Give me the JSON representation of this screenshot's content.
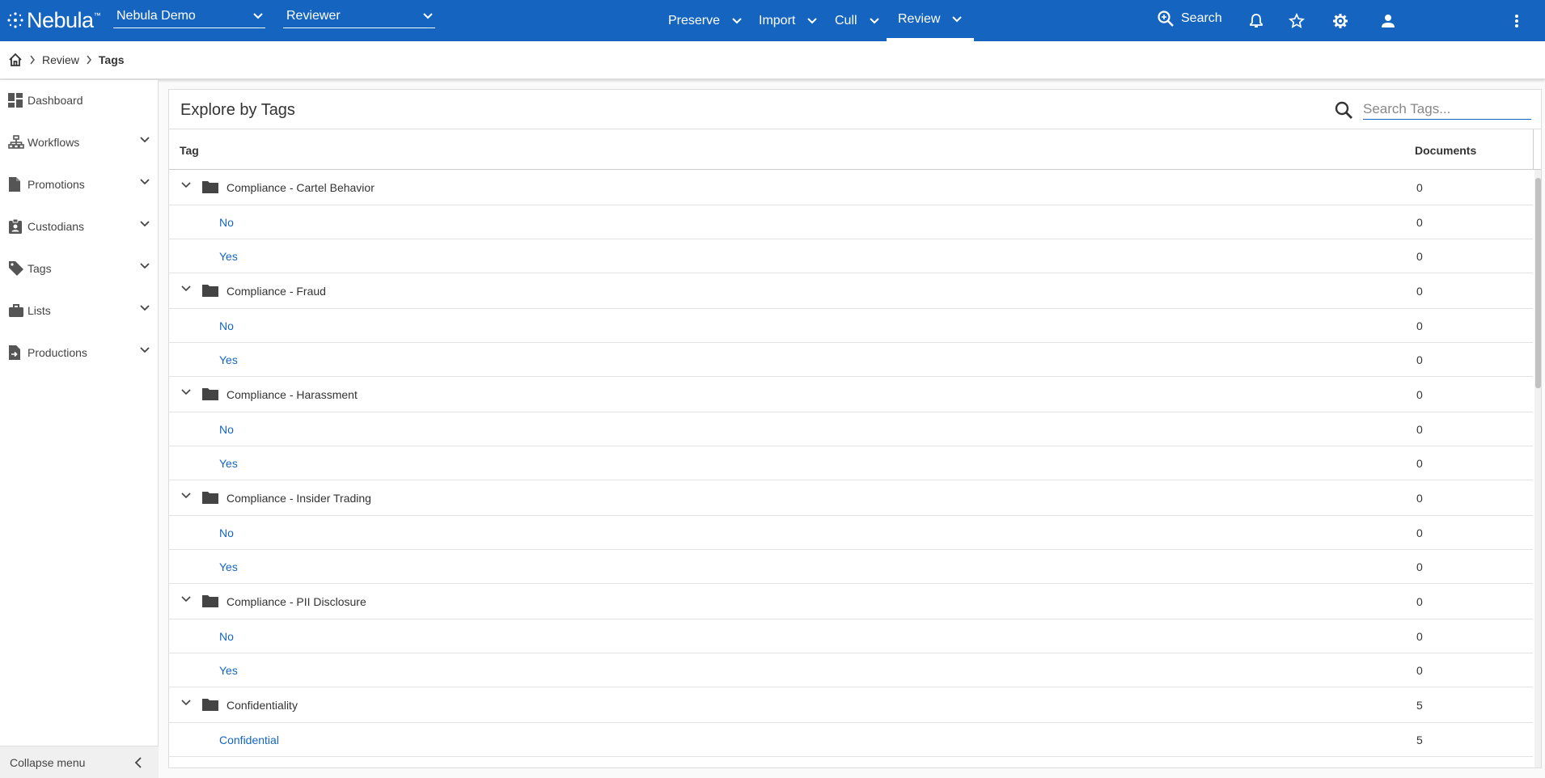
{
  "app": {
    "logo_text": "Nebula",
    "logo_mark": "™"
  },
  "header": {
    "project_select": "Nebula Demo",
    "role_select": "Reviewer",
    "nav": [
      {
        "label": "Preserve",
        "active": false
      },
      {
        "label": "Import",
        "active": false
      },
      {
        "label": "Cull",
        "active": false
      },
      {
        "label": "Review",
        "active": true
      }
    ],
    "search_label": "Search",
    "icons": [
      "search-icon",
      "bell-icon",
      "star-icon",
      "gear-icon",
      "account-icon",
      "more-vert-icon"
    ],
    "color": "#1565c0"
  },
  "breadcrumb": {
    "items": [
      "Review",
      "Tags"
    ]
  },
  "sidebar": {
    "items": [
      {
        "label": "Dashboard",
        "icon": "dashboard-icon",
        "expandable": false
      },
      {
        "label": "Workflows",
        "icon": "sitemap-icon",
        "expandable": true
      },
      {
        "label": "Promotions",
        "icon": "document-icon",
        "expandable": true
      },
      {
        "label": "Custodians",
        "icon": "badge-icon",
        "expandable": true
      },
      {
        "label": "Tags",
        "icon": "tag-icon",
        "expandable": true
      },
      {
        "label": "Lists",
        "icon": "briefcase-icon",
        "expandable": true
      },
      {
        "label": "Productions",
        "icon": "document-export-icon",
        "expandable": true
      }
    ],
    "collapse_label": "Collapse menu"
  },
  "panel": {
    "title": "Explore by Tags",
    "search_placeholder": "Search Tags...",
    "columns": {
      "tag": "Tag",
      "documents": "Documents"
    }
  },
  "tags": [
    {
      "name": "Compliance - Cartel Behavior",
      "count": "0",
      "children": [
        {
          "name": "No",
          "count": "0"
        },
        {
          "name": "Yes",
          "count": "0"
        }
      ]
    },
    {
      "name": "Compliance - Fraud",
      "count": "0",
      "children": [
        {
          "name": "No",
          "count": "0"
        },
        {
          "name": "Yes",
          "count": "0"
        }
      ]
    },
    {
      "name": "Compliance - Harassment",
      "count": "0",
      "children": [
        {
          "name": "No",
          "count": "0"
        },
        {
          "name": "Yes",
          "count": "0"
        }
      ]
    },
    {
      "name": "Compliance - Insider Trading",
      "count": "0",
      "children": [
        {
          "name": "No",
          "count": "0"
        },
        {
          "name": "Yes",
          "count": "0"
        }
      ]
    },
    {
      "name": "Compliance - PII Disclosure",
      "count": "0",
      "children": [
        {
          "name": "No",
          "count": "0"
        },
        {
          "name": "Yes",
          "count": "0"
        }
      ]
    },
    {
      "name": "Confidentiality",
      "count": "5",
      "children": [
        {
          "name": "Confidential",
          "count": "5"
        }
      ]
    }
  ]
}
